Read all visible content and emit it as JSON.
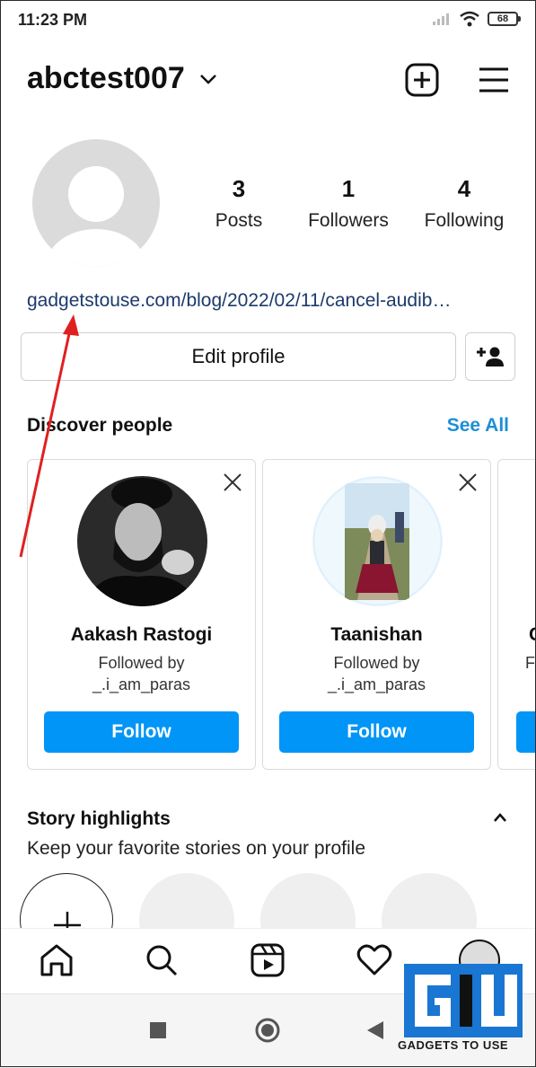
{
  "status": {
    "time": "11:23 PM",
    "battery": "68"
  },
  "header": {
    "username": "abctest007"
  },
  "profile": {
    "stats": [
      {
        "num": "3",
        "label": "Posts"
      },
      {
        "num": "1",
        "label": "Followers"
      },
      {
        "num": "4",
        "label": "Following"
      }
    ],
    "link": "gadgetstouse.com/blog/2022/02/11/cancel-audib…",
    "edit_label": "Edit profile"
  },
  "discover": {
    "title": "Discover people",
    "see_all": "See All",
    "cards": [
      {
        "name": "Aakash Rastogi",
        "followed_by": "Followed by",
        "follower": "_.i_am_paras",
        "button": "Follow"
      },
      {
        "name": "Taanishan",
        "followed_by": "Followed by",
        "follower": "_.i_am_paras",
        "button": "Follow"
      }
    ],
    "partial_card": {
      "name": "C",
      "followed_by": "F"
    }
  },
  "highlights": {
    "title": "Story highlights",
    "subtitle": "Keep your favorite stories on your profile"
  },
  "watermark": {
    "text": "GADGETS TO USE"
  },
  "colors": {
    "accent": "#0095f6",
    "link": "#1c3a6b",
    "annotation_arrow": "#e02020"
  },
  "icons": [
    "new-post-icon",
    "menu-icon",
    "add-person-icon",
    "close-icon",
    "chevron-up-icon",
    "home-icon",
    "search-icon",
    "reels-icon",
    "heart-icon"
  ]
}
